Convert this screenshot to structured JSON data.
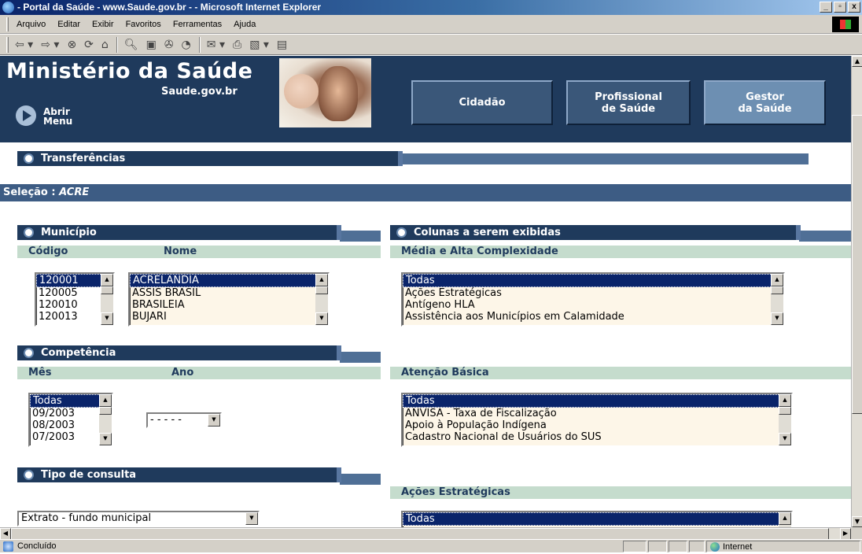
{
  "window": {
    "title": "- Portal da Saúde - www.Saude.gov.br - - Microsoft Internet Explorer"
  },
  "menu": [
    "Arquivo",
    "Editar",
    "Exibir",
    "Favoritos",
    "Ferramentas",
    "Ajuda"
  ],
  "site": {
    "title": "Ministério da Saúde",
    "subtitle": "Saude.gov.br",
    "menu_label": "Abrir\nMenu",
    "nav": [
      "Cidadão",
      "Profissional\nde Saúde",
      "Gestor\nda Saúde"
    ]
  },
  "sections": {
    "transferencias": "Transferências",
    "selecao_label": "Seleção : ",
    "selecao_value": "ACRE",
    "municipio": "Município",
    "colunas": "Colunas a serem exibidas",
    "competencia": "Competência",
    "tipo_consulta": "Tipo de consulta"
  },
  "municipio": {
    "col_codigo": "Código",
    "col_nome": "Nome",
    "codes": [
      "120001",
      "120005",
      "120010",
      "120013"
    ],
    "names": [
      "ACRELANDIA",
      "ASSIS BRASIL",
      "BRASILEIA",
      "BUJARI"
    ]
  },
  "competencia": {
    "col_mes": "Mês",
    "col_ano": "Ano",
    "months": [
      "Todas",
      "09/2003",
      "08/2003",
      "07/2003"
    ],
    "year_value": "- - - - -"
  },
  "tipo_consulta": {
    "value": "Extrato - fundo municipal"
  },
  "media_alta": {
    "header": "Média e Alta Complexidade",
    "items": [
      "Todas",
      "Ações Estratégicas",
      "Antígeno HLA",
      "Assistência aos Municípios em Calamidade"
    ]
  },
  "atencao_basica": {
    "header": "Atenção Básica",
    "items": [
      "Todas",
      "ANVISA - Taxa de Fiscalização",
      "Apoio à População Indígena",
      "Cadastro Nacional de Usuários do SUS"
    ]
  },
  "acoes_estrategicas": {
    "header": "Ações Estratégicas",
    "items": [
      "Todas"
    ]
  },
  "status": {
    "text": "Concluído",
    "zone": "Internet"
  }
}
